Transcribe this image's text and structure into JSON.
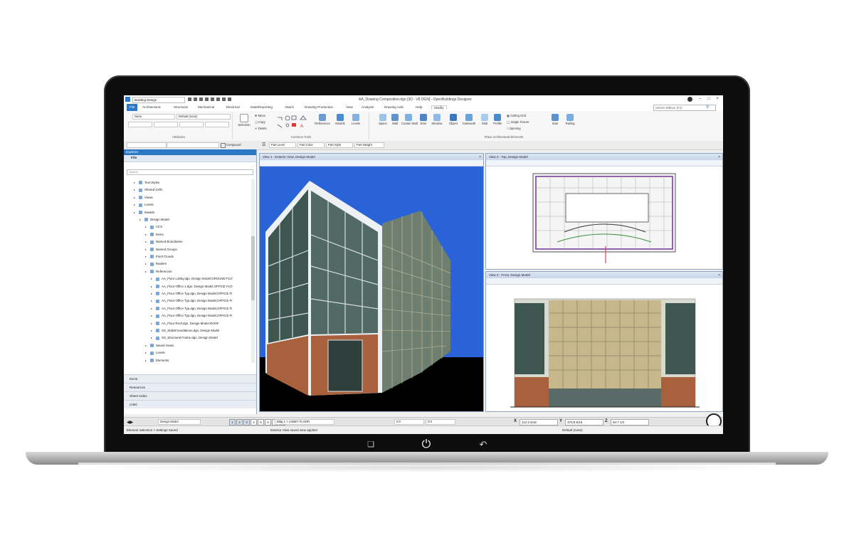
{
  "titlebar": {
    "workspace": "Building Design",
    "title": "AA_Drawing Composition.dgn [3D - V8 DGN] - OpenBuildings Designer"
  },
  "menu": [
    "File",
    "Architectural",
    "Structural",
    "Mechanical",
    "Electrical",
    "Data/Reporting",
    "Attach",
    "Drawing Production",
    "View",
    "Analysis",
    "Drawing Aids",
    "Help",
    "Modify"
  ],
  "search_placeholder": "Search Ribbon (F4)",
  "ribbon": {
    "attributes": {
      "label": "Attributes",
      "level_value": "None",
      "style_value": "Default (none)"
    },
    "common_tools": {
      "label": "Common Tools",
      "selection": "Selection",
      "move": "Move",
      "copy": "Copy",
      "delete": "Delete",
      "references": "References",
      "models": "Models",
      "levels": "Levels"
    },
    "place": {
      "label": "Place Architectural Elements",
      "space": "Space",
      "wall": "Wall",
      "curtain_wall": "Curtain Wall",
      "door": "Door",
      "window": "Window",
      "object": "Object",
      "casework": "Casework",
      "slab": "Slab",
      "profile": "Profile",
      "ceiling_grid": "Ceiling Grid",
      "single_fixture": "Single Fixture",
      "opening": "Opening",
      "stair": "Stair",
      "railing": "Railing"
    }
  },
  "toolbar2": {
    "compound": "Compound",
    "part_level": "Part Level",
    "part_color": "Part Color",
    "part_style": "Part Style",
    "part_weight": "Part Weight"
  },
  "explorer": {
    "title": "Explorer",
    "file_section": "File",
    "search_placeholder": "Search",
    "tree": [
      {
        "label": "Text Styles",
        "indent": 1
      },
      {
        "label": "Shared Cells",
        "indent": 1
      },
      {
        "label": "Views",
        "indent": 1
      },
      {
        "label": "Levels",
        "indent": 1
      },
      {
        "label": "Models",
        "indent": 1
      },
      {
        "label": "Design Model",
        "indent": 2
      },
      {
        "label": "ACS",
        "indent": 3
      },
      {
        "label": "Items",
        "indent": 3
      },
      {
        "label": "Named Boundaries",
        "indent": 3
      },
      {
        "label": "Named Groups",
        "indent": 3
      },
      {
        "label": "Point Clouds",
        "indent": 3
      },
      {
        "label": "Rasters",
        "indent": 3
      },
      {
        "label": "References",
        "indent": 3
      },
      {
        "label": "AA_Floor Lobby.dgn, Design Model,GROUND FLO",
        "indent": 4
      },
      {
        "label": "AA_Floor Office 1.dgn, Design Model,OFFICE FLO",
        "indent": 4
      },
      {
        "label": "AA_Floor Office Typ.dgn, Design Model,OFFICE FI",
        "indent": 4
      },
      {
        "label": "AA_Floor Office Typ.dgn, Design Model,OFFICE FI",
        "indent": 4
      },
      {
        "label": "AA_Floor Office Typ.dgn, Design Model,OFFICE FI",
        "indent": 4
      },
      {
        "label": "AA_Floor Office Typ.dgn, Design Model,OFFICE FI",
        "indent": 4
      },
      {
        "label": "AA_Floor Roof.dgn, Design Model,ROOF",
        "indent": 4
      },
      {
        "label": "SS_SlabsFoundations.dgn, Design Model",
        "indent": 4
      },
      {
        "label": "SS_Structural Frame.dgn, Design Model",
        "indent": 4
      },
      {
        "label": "Saved Views",
        "indent": 3
      },
      {
        "label": "Levels",
        "indent": 3
      },
      {
        "label": "Elements",
        "indent": 3
      }
    ],
    "panels": [
      "Items",
      "Resources",
      "Sheet Index",
      "Links"
    ]
  },
  "views": {
    "v1": "View 1 - Exterior View, Design Model",
    "v2": "View 2 - Top, Design Model",
    "v3": "View 3 - Front, Design Model"
  },
  "status": {
    "model": "Design Model",
    "view_numbers": [
      "1",
      "2",
      "3",
      "4",
      "5",
      "6",
      "7",
      "8"
    ],
    "floor": "Bldg 1 > LOBBY FLOOR",
    "offset1": "0:0",
    "offset2": "0:0",
    "x_label": "X",
    "x_value": "112:2 5/16",
    "y_label": "Y",
    "y_value": "370:5 5/16",
    "z_label": "Z",
    "z_value": "94:7 1/4",
    "default_style": "Default (none)",
    "message_left": "Element Selection > Settings Saved",
    "message_center": "Exterior View saved view applied"
  },
  "colors": {
    "accent": "#2b78c5",
    "sky": "#2a63d8",
    "brick": "#a8603d",
    "glass": "#3e5650"
  }
}
